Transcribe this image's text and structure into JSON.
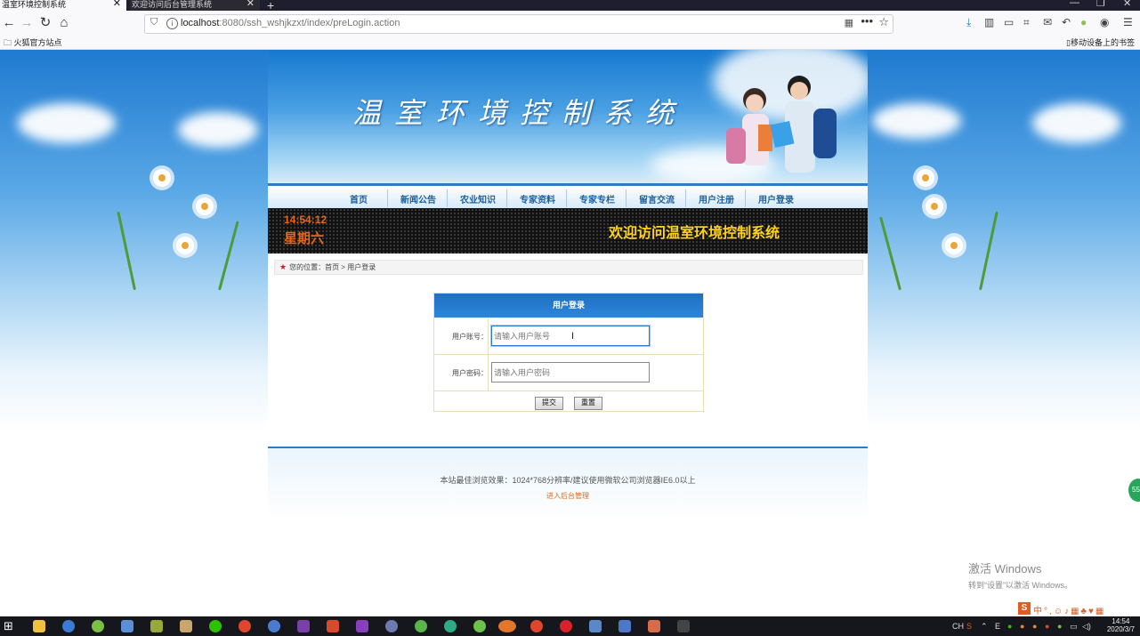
{
  "browser": {
    "tabs": [
      {
        "label": "温室环境控制系统",
        "active": true
      },
      {
        "label": "欢迎访问后台管理系统",
        "active": false
      }
    ],
    "new_tab": "+",
    "tab_close": "✕",
    "url": "localhost:8080/ssh_wshjkzxt/index/preLogin.action",
    "url_host": "localhost",
    "url_rest": ":8080/ssh_wshjkzxt/index/preLogin.action",
    "bookmark_folder": "火狐官方站点",
    "mobile_bookmarks": "移动设备上的书签",
    "menu_dots": "•••"
  },
  "site": {
    "title": "温室环境控制系统",
    "nav": [
      "首页",
      "新闻公告",
      "农业知识",
      "专家资料",
      "专家专栏",
      "留言交流",
      "用户注册",
      "用户登录"
    ],
    "ticker": {
      "time": "14:54:12",
      "day": "星期六",
      "welcome": "欢迎访问温室环境控制系统"
    },
    "breadcrumb": {
      "prefix": "您的位置：",
      "home": "首页",
      "sep": " > ",
      "current": "用户登录"
    }
  },
  "login": {
    "heading": "用户登录",
    "account_label": "用户账号：",
    "account_placeholder": "请输入用户账号",
    "account_value": "",
    "password_label": "用户密码：",
    "password_placeholder": "请输入用户密码",
    "password_value": "",
    "submit": "提交",
    "reset": "重置"
  },
  "footer": {
    "note": "本站最佳浏览效果：1024*768分辨率/建议使用微软公司浏览器IE6.0以上",
    "admin_link": "进入后台管理"
  },
  "windows": {
    "activate_title": "激活 Windows",
    "activate_sub": "转到“设置”以激活 Windows。",
    "clock_time": "14:54",
    "clock_date": "2020/3/7",
    "ime_icon": "S",
    "ime_text": "中°,☺♪▦♣♥▦",
    "tray_lang": "CH",
    "side_badge": "55"
  },
  "colors": {
    "accent_blue": "#2e7cc4",
    "ticker_orange": "#e5661d",
    "ticker_yellow": "#ffd21a",
    "admin_link": "#e06a12"
  }
}
